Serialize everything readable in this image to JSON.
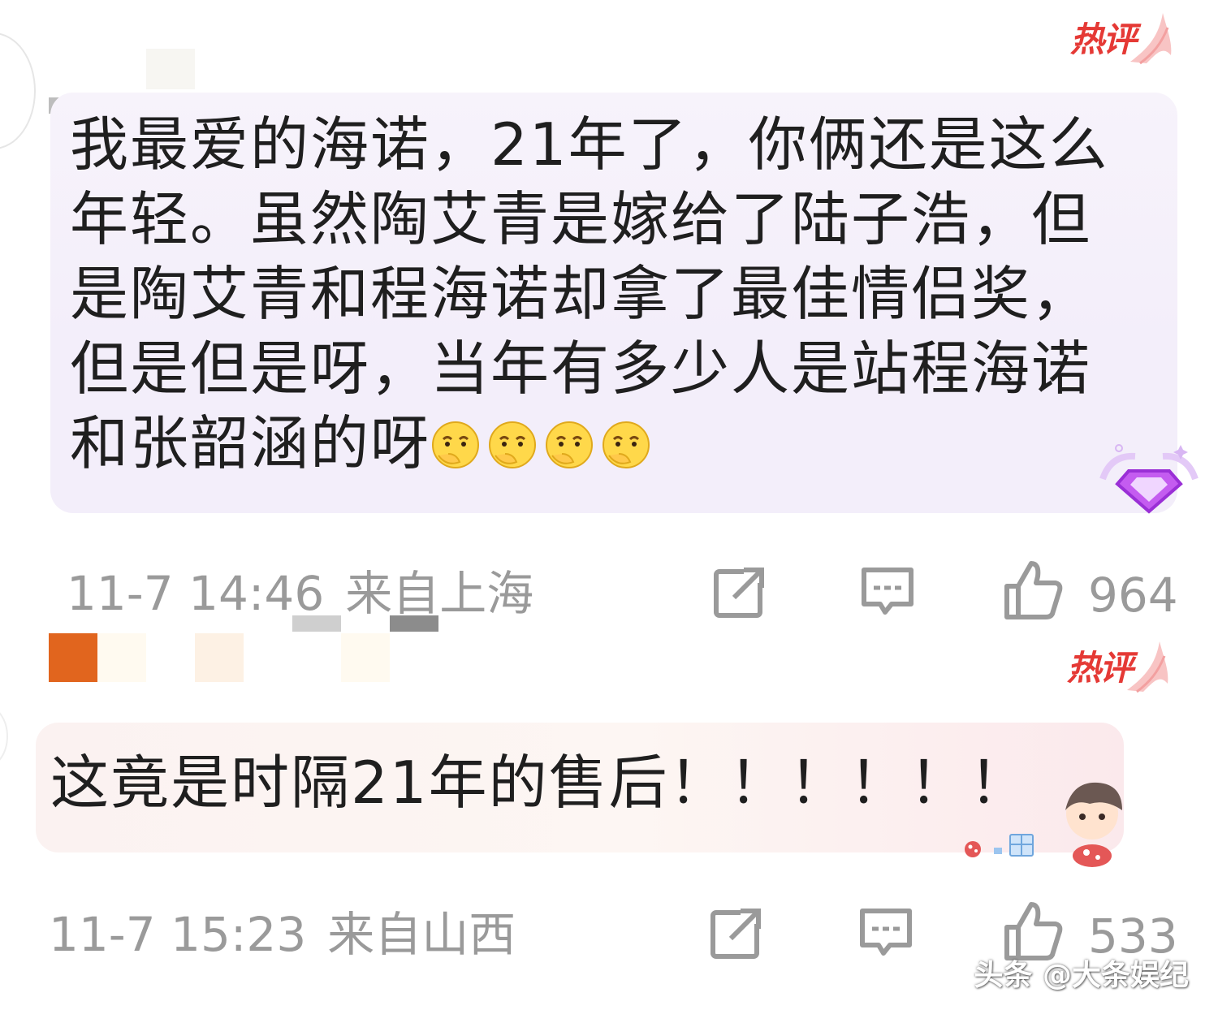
{
  "comments": [
    {
      "badge": "热评",
      "text": "我最爱的海诺，21年了，你俩还是这么年轻。虽然陶艾青是嫁给了陆子浩，但是陶艾青和程海诺却拿了最佳情侣奖，但是但是呀，当年有多少人是站程海诺和张韶涵的呀",
      "emoji_count": 4,
      "emoji_name": "thinking-face-icon",
      "time": "11-7 14:46",
      "location": "来自上海",
      "likes": "964"
    },
    {
      "badge": "热评",
      "text": "这竟是时隔21年的售后！！！！！！",
      "time": "11-7 15:23",
      "location": "来自山西",
      "likes": "533"
    }
  ],
  "actions": {
    "share_icon": "share-icon",
    "reply_icon": "comment-icon",
    "like_icon": "thumbs-up-icon"
  },
  "watermark": "头条 @大条娱纪",
  "colors": {
    "badge_red": "#e53935",
    "meta_gray": "#9a9a9a",
    "bubble1": "#f3eefa",
    "bubble2": "#fbf2f1"
  }
}
